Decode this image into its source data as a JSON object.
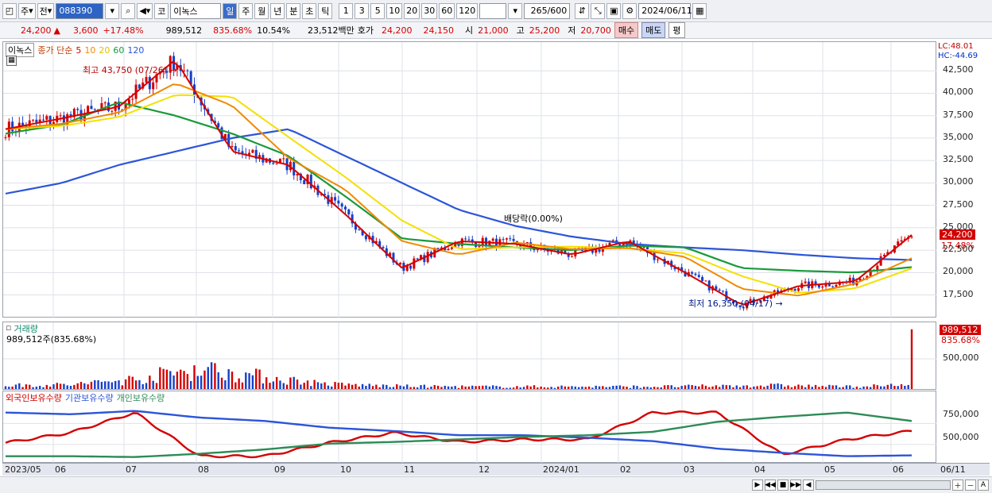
{
  "toolbar": {
    "type_label": "주",
    "scope_label": "전",
    "code": "088390",
    "market_label": "코",
    "stock_name": "이녹스",
    "periods": [
      "일",
      "주",
      "월",
      "년",
      "분",
      "초",
      "틱"
    ],
    "intervals": [
      "1",
      "3",
      "5",
      "10",
      "20",
      "30",
      "60",
      "120"
    ],
    "count": "265",
    "count_total": "/600",
    "date": "2024/06/11"
  },
  "quote": {
    "price": "24,200",
    "arrow": "▲",
    "change": "3,600",
    "change_pct": "+17.48%",
    "volume": "989,512",
    "volume_pct": "835.68%",
    "turnover": "10.54%",
    "amount": "23,512백만",
    "ask_label": "호가",
    "ask": "24,200",
    "bid": "24,150",
    "open_label": "시",
    "open": "21,000",
    "high_label": "고",
    "high": "25,200",
    "low_label": "저",
    "low": "20,700",
    "buy_label": "매수",
    "sell_label": "매도",
    "eval_label": "평"
  },
  "price_panel": {
    "name": "이녹스",
    "ma_label": "종가 단순",
    "ma_periods": [
      "5",
      "10",
      "20",
      "60",
      "120"
    ],
    "ma_colors": [
      "#d40000",
      "#f08a00",
      "#f4e000",
      "#1a9a3a",
      "#2c55d8"
    ],
    "lc": "LC:48.01",
    "hc": "HC:-44.69",
    "current_price": "24,200",
    "current_pct": "17.48%",
    "high_note": "최고 43,750 (07/26)",
    "low_note": "최저 16,350 (04/17)",
    "dividend_note": "배당락(0.00%)"
  },
  "volume_panel": {
    "title": "거래량",
    "value": "989,512주(835.68%)",
    "current": "989,512",
    "current_pct": "835.68%"
  },
  "holding_panel": {
    "series": [
      {
        "name": "외국인보유수량",
        "color": "#d40000"
      },
      {
        "name": "기관보유수량",
        "color": "#2c55d8"
      },
      {
        "name": "개인보유수량",
        "color": "#2e8b57"
      }
    ]
  },
  "x_axis": {
    "months": [
      "2023/05",
      "06",
      "07",
      "08",
      "09",
      "10",
      "11",
      "12",
      "2024/01",
      "02",
      "03",
      "04",
      "05",
      "06",
      "06/11"
    ]
  },
  "chart_data": [
    {
      "type": "line",
      "title": "",
      "y_ticks": [
        "42,500",
        "40,000",
        "37,500",
        "35,000",
        "32,500",
        "30,000",
        "27,500",
        "25,000",
        "22,500",
        "20,000",
        "17,500"
      ],
      "ylim": [
        15600,
        45000
      ],
      "x": [
        "2023/05",
        "06",
        "07",
        "07/26",
        "08",
        "09",
        "10",
        "11",
        "12",
        "2024/01",
        "02",
        "03",
        "04",
        "04/17",
        "05",
        "06",
        "06/11"
      ],
      "series": [
        {
          "name": "5",
          "values": [
            36000,
            37200,
            38500,
            43750,
            33500,
            32000,
            26500,
            20500,
            23500,
            23200,
            22000,
            23500,
            20000,
            16350,
            18500,
            19000,
            24200
          ]
        },
        {
          "name": "60",
          "values": [
            35500,
            36500,
            39000,
            37500,
            35500,
            33000,
            28500,
            23800,
            23200,
            22800,
            22500,
            23000,
            22800,
            20500,
            20200,
            20000,
            20600
          ]
        },
        {
          "name": "120",
          "values": [
            28800,
            30000,
            32000,
            33500,
            35000,
            36000,
            33000,
            30000,
            27000,
            25200,
            24000,
            23200,
            22800,
            22500,
            22000,
            21600,
            21400
          ]
        }
      ]
    },
    {
      "type": "bar",
      "title": "",
      "y_ticks": [
        "500,000"
      ],
      "ylim": [
        0,
        1000000
      ],
      "categories": [
        "2023/05",
        "06",
        "07",
        "07/26",
        "08",
        "09",
        "10",
        "11",
        "12",
        "2024/01",
        "02",
        "03",
        "04",
        "05",
        "06",
        "06/11"
      ],
      "values": [
        60000,
        70000,
        160000,
        340000,
        200000,
        80000,
        50000,
        40000,
        40000,
        40000,
        40000,
        50000,
        60000,
        40000,
        60000,
        989512
      ]
    },
    {
      "type": "line",
      "title": "",
      "y_ticks": [
        "750,000",
        "500,000"
      ],
      "ylim": [
        300000,
        1000000
      ],
      "x": [
        "2023/05",
        "06",
        "07",
        "08",
        "09",
        "10",
        "11",
        "12",
        "2024/01",
        "02",
        "03",
        "04",
        "05",
        "06",
        "06/11"
      ],
      "series": [
        {
          "name": "외국인보유수량",
          "values": [
            520000,
            640000,
            880000,
            360000,
            360000,
            520000,
            640000,
            530000,
            560000,
            560000,
            880000,
            880000,
            380000,
            560000,
            660000
          ]
        },
        {
          "name": "기관보유수량",
          "values": [
            880000,
            860000,
            900000,
            820000,
            780000,
            700000,
            660000,
            610000,
            610000,
            580000,
            540000,
            450000,
            400000,
            360000,
            370000
          ]
        },
        {
          "name": "개인보유수량",
          "values": [
            360000,
            360000,
            350000,
            390000,
            440000,
            510000,
            530000,
            560000,
            590000,
            610000,
            650000,
            770000,
            830000,
            880000,
            780000
          ]
        }
      ]
    }
  ]
}
